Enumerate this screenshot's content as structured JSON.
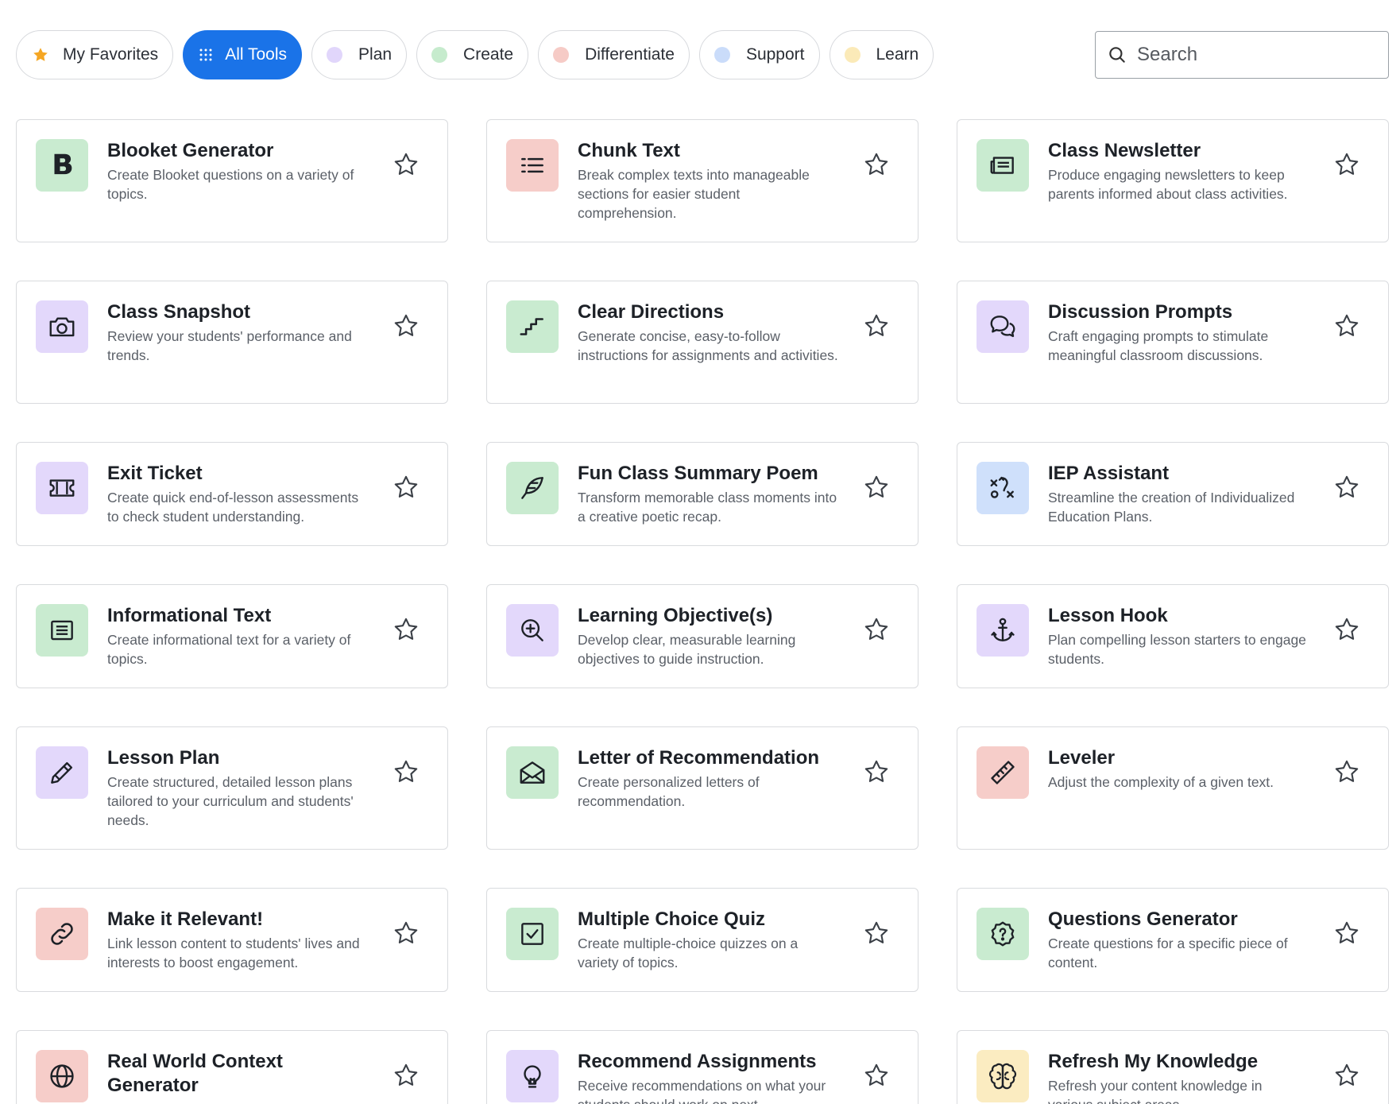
{
  "filters": [
    {
      "label": "My Favorites",
      "kind": "favorites"
    },
    {
      "label": "All Tools",
      "kind": "all",
      "active": true
    },
    {
      "label": "Plan",
      "color": "#e1d6fb"
    },
    {
      "label": "Create",
      "color": "#c6ebcd"
    },
    {
      "label": "Differentiate",
      "color": "#f6cbc6"
    },
    {
      "label": "Support",
      "color": "#cadcfa"
    },
    {
      "label": "Learn",
      "color": "#fbeab8"
    }
  ],
  "search": {
    "placeholder": "Search"
  },
  "tools": [
    {
      "title": "Blooket Generator",
      "desc": "Create Blooket questions on a variety of topics.",
      "icon": "blooket-logo-icon",
      "bg": "green"
    },
    {
      "title": "Chunk Text",
      "desc": "Break complex texts into manageable sections for easier student comprehension.",
      "icon": "list-lines-icon",
      "bg": "red"
    },
    {
      "title": "Class Newsletter",
      "desc": "Produce engaging newsletters to keep parents informed about class activities.",
      "icon": "newspaper-icon",
      "bg": "green"
    },
    {
      "title": "Class Snapshot",
      "desc": "Review your students' performance and trends.",
      "icon": "camera-icon",
      "bg": "purple"
    },
    {
      "title": "Clear Directions",
      "desc": "Generate concise, easy-to-follow instructions for assignments and activities.",
      "icon": "stairs-icon",
      "bg": "green"
    },
    {
      "title": "Discussion Prompts",
      "desc": "Craft engaging prompts to stimulate meaningful classroom discussions.",
      "icon": "chat-bubbles-icon",
      "bg": "purple"
    },
    {
      "title": "Exit Ticket",
      "desc": "Create quick end-of-lesson assessments to check student understanding.",
      "icon": "ticket-icon",
      "bg": "purple"
    },
    {
      "title": "Fun Class Summary Poem",
      "desc": "Transform memorable class moments into a creative poetic recap.",
      "icon": "feather-icon",
      "bg": "green"
    },
    {
      "title": "IEP Assistant",
      "desc": "Streamline the creation of Individualized Education Plans.",
      "icon": "strategy-icon",
      "bg": "blue"
    },
    {
      "title": "Informational Text",
      "desc": "Create informational text for a variety of topics.",
      "icon": "text-document-icon",
      "bg": "green"
    },
    {
      "title": "Learning Objective(s)",
      "desc": "Develop clear, measurable learning objectives to guide instruction.",
      "icon": "zoom-in-icon",
      "bg": "purple"
    },
    {
      "title": "Lesson Hook",
      "desc": "Plan compelling lesson starters to engage students.",
      "icon": "anchor-icon",
      "bg": "purple"
    },
    {
      "title": "Lesson Plan",
      "desc": "Create structured, detailed lesson plans tailored to your curriculum and students' needs.",
      "icon": "pencil-icon",
      "bg": "purple"
    },
    {
      "title": "Letter of Recommendation",
      "desc": "Create personalized letters of recommendation.",
      "icon": "open-envelope-icon",
      "bg": "green"
    },
    {
      "title": "Leveler",
      "desc": "Adjust the complexity of a given text.",
      "icon": "ruler-icon",
      "bg": "red"
    },
    {
      "title": "Make it Relevant!",
      "desc": "Link lesson content to students' lives and interests to boost engagement.",
      "icon": "link-icon",
      "bg": "red"
    },
    {
      "title": "Multiple Choice Quiz",
      "desc": "Create multiple-choice quizzes on a variety of topics.",
      "icon": "checkbox-icon",
      "bg": "green"
    },
    {
      "title": "Questions Generator",
      "desc": "Create questions for a specific piece of content.",
      "icon": "question-badge-icon",
      "bg": "green"
    },
    {
      "title": "Real World Context Generator",
      "desc": "",
      "icon": "globe-icon",
      "bg": "red",
      "two_line": true
    },
    {
      "title": "Recommend Assignments",
      "desc": "Receive recommendations on what your students should work on next.",
      "icon": "lightbulb-icon",
      "bg": "purple"
    },
    {
      "title": "Refresh My Knowledge",
      "desc": "Refresh your content knowledge in various subject areas.",
      "icon": "brain-icon",
      "bg": "yellow"
    }
  ]
}
